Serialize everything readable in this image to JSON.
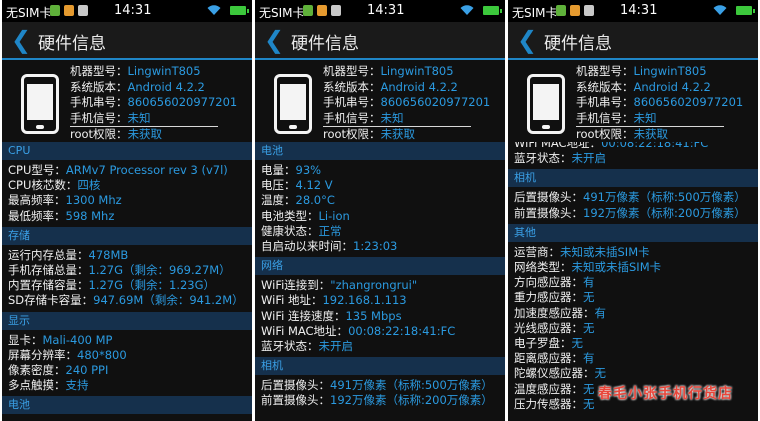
{
  "status": {
    "carrier": "无SIM卡",
    "time": "14:31"
  },
  "header": {
    "back": "❮",
    "title": "硬件信息"
  },
  "device": {
    "model_label": "机器型号：",
    "model": "LingwinT805",
    "os_label": "系统版本：",
    "os": "Android 4.2.2",
    "serial_label": "手机串号：",
    "serial": "860656020977201",
    "signal_label": "手机信号：",
    "signal": "未知",
    "root_label": "root权限：",
    "root": "未获取"
  },
  "sections": {
    "cpu": "CPU",
    "storage": "存储",
    "display": "显示",
    "battery": "电池",
    "network": "网络",
    "camera": "相机",
    "other": "其他"
  },
  "cpu": {
    "type_label": "CPU型号：",
    "type": "ARMv7 Processor rev 3 (v7l)",
    "cores_label": "CPU核芯数：",
    "cores": "四核",
    "maxf_label": "最高频率：",
    "maxf": "1300 Mhz",
    "minf_label": "最低频率：",
    "minf": "598 Mhz"
  },
  "storage": {
    "ram_label": "运行内存总量：",
    "ram": "478MB",
    "phone_label": "手机存储总量：",
    "phone": "1.27G（剩余：969.27M）",
    "internal_label": "内置存储容量：",
    "internal": "1.27G（剩余：1.23G）",
    "sd_label": "SD存储卡容量：",
    "sd": "947.69M（剩余：941.2M）"
  },
  "display": {
    "gpu_label": "显卡：",
    "gpu": "Mali-400 MP",
    "res_label": "屏幕分辨率：",
    "res": "480*800",
    "ppi_label": "像素密度：",
    "ppi": "240 PPI",
    "touch_label": "多点触摸：",
    "touch": "支持"
  },
  "battery": {
    "level_label": "电量：",
    "level": "93%",
    "voltage_label": "电压：",
    "voltage": "4.12 V",
    "temp_label": "温度：",
    "temp": "28.0°C",
    "type_label": "电池类型：",
    "type": "Li-ion",
    "health_label": "健康状态：",
    "health": "正常",
    "uptime_label": "自启动以来时间：",
    "uptime": "1:23:03"
  },
  "network": {
    "wifi_label": "WiFi连接到：",
    "wifi": "\"zhangrongrui\"",
    "ip_label": "WiFi 地址：",
    "ip": "192.168.1.113",
    "speed_label": "WiFi 连接速度：",
    "speed": "135 Mbps",
    "mac_label": "WiFi MAC地址：",
    "mac": "00:08:22:18:41:FC",
    "bt_label": "蓝牙状态：",
    "bt": "未开启"
  },
  "camera": {
    "rear_label": "后置摄像头：",
    "rear": "491万像素（标称:500万像素）",
    "front_label": "前置摄像头：",
    "front": "192万像素（标称:200万像素）"
  },
  "other": {
    "op_label": "运营商：",
    "op": "未知或未插SIM卡",
    "nettype_label": "网络类型：",
    "nettype": "未知或未插SIM卡",
    "dir_label": "方向感应器：",
    "dir": "有",
    "grav_label": "重力感应器：",
    "grav": "无",
    "acc_label": "加速度感应器：",
    "acc": "有",
    "light_label": "光线感应器：",
    "light": "无",
    "compass_label": "电子罗盘：",
    "compass": "无",
    "prox_label": "距离感应器：",
    "prox": "有",
    "gyro_label": "陀螺仪感应器：",
    "gyro": "无",
    "tempsens_label": "温度感应器：",
    "tempsens": "无",
    "press_label": "压力传感器：",
    "press": "无"
  },
  "watermark": "春毛小张手机行货店"
}
